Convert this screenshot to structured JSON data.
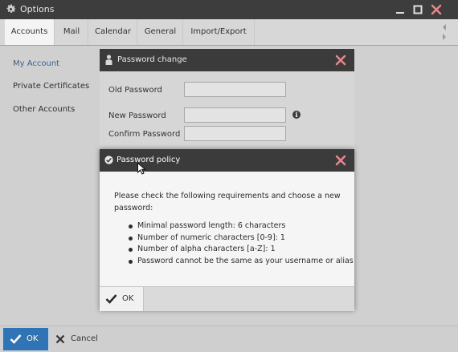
{
  "window": {
    "title": "Options",
    "minimize_icon": "minimize-icon",
    "maximize_icon": "maximize-icon",
    "close_icon": "close-icon"
  },
  "tabs": [
    {
      "label": "Accounts",
      "active": true
    },
    {
      "label": "Mail",
      "active": false
    },
    {
      "label": "Calendar",
      "active": false
    },
    {
      "label": "General",
      "active": false
    },
    {
      "label": "Import/Export",
      "active": false
    }
  ],
  "sidebar": {
    "items": [
      {
        "label": "My Account",
        "active": true
      },
      {
        "label": "Private Certificates",
        "active": false
      },
      {
        "label": "Other Accounts",
        "active": false
      }
    ]
  },
  "footer": {
    "ok_label": "OK",
    "cancel_label": "Cancel"
  },
  "password_dialog": {
    "title": "Password change",
    "old_password_label": "Old Password",
    "new_password_label": "New Password",
    "confirm_password_label": "Confirm Password",
    "old_password_value": "",
    "new_password_value": "",
    "confirm_password_value": ""
  },
  "policy_dialog": {
    "title": "Password policy",
    "intro": "Please check the following requirements and choose a new password:",
    "requirements": [
      "Minimal password length: 6 characters",
      "Number of numeric characters [0-9]: 1",
      "Number of alpha characters [a-Z]: 1",
      "Password cannot be the same as your username or alias"
    ],
    "ok_label": "OK"
  },
  "colors": {
    "accent": "#2f74b5",
    "title_bar": "#3d3d3d",
    "close_x": "#e8838a"
  }
}
